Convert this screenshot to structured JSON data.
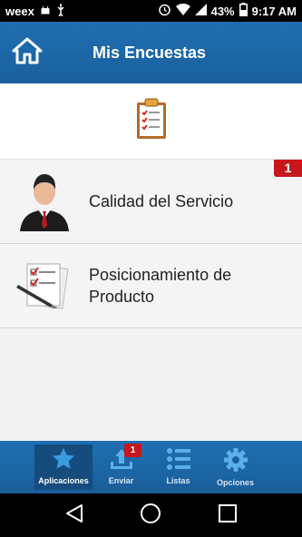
{
  "status_bar": {
    "carrier": "weex",
    "battery_percent": "43%",
    "time": "9:17 AM"
  },
  "header": {
    "title": "Mis Encuestas"
  },
  "surveys": [
    {
      "title_line1": "Calidad del Servicio",
      "title_line2": "",
      "badge": "1",
      "icon": "businessman-icon"
    },
    {
      "title_line1": "Posicionamiento de",
      "title_line2": "Producto",
      "badge": "",
      "icon": "checklist-pen-icon"
    }
  ],
  "bottom_nav": {
    "items": [
      {
        "label": "Aplicaciones",
        "icon": "star-icon",
        "active": true
      },
      {
        "label": "Enviar",
        "icon": "upload-tray-icon",
        "badge": "1"
      },
      {
        "label": "Listas",
        "icon": "list-icon"
      },
      {
        "label": "Opciones",
        "icon": "gear-icon"
      }
    ]
  },
  "colors": {
    "header_blue": "#1f6fb2",
    "badge_red": "#c8161d",
    "active_tab": "#154c7d"
  }
}
